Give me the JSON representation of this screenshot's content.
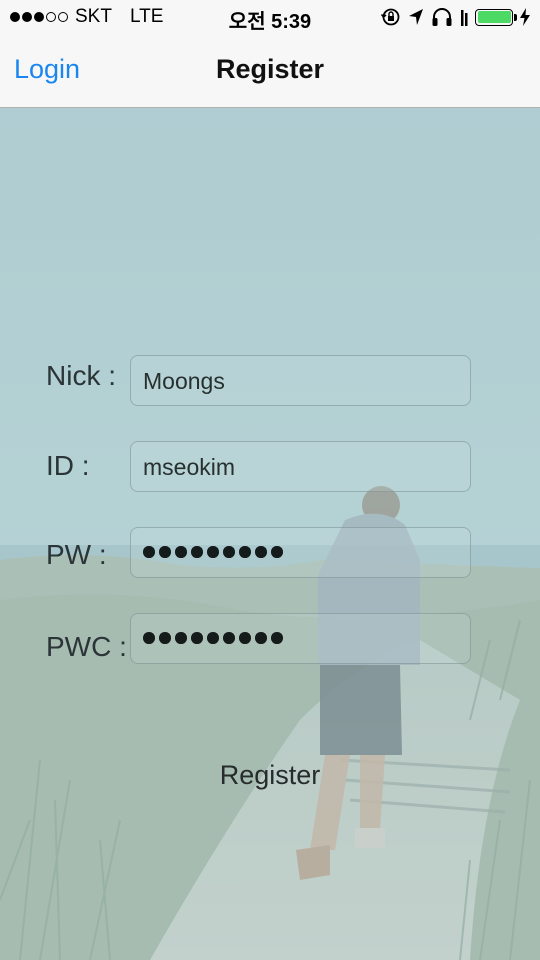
{
  "status_bar": {
    "carrier": "SKT",
    "network": "LTE",
    "time": "오전 5:39",
    "signal_bars_filled": 3,
    "signal_bars_total": 5,
    "battery_level": 1.0,
    "battery_color": "#4cd964",
    "icons": [
      "orientation-lock-icon",
      "location-arrow-icon",
      "headphones-icon",
      "battery-icon",
      "charging-bolt-icon"
    ]
  },
  "nav": {
    "back_label": "Login",
    "title": "Register",
    "accent_color": "#1a87f0"
  },
  "form": {
    "nick": {
      "label": "Nick :",
      "value": "Moongs"
    },
    "id": {
      "label": "ID :",
      "value": "mseokim"
    },
    "pw": {
      "label": "PW :",
      "masked_length": 9
    },
    "pwc": {
      "label": "PWC :",
      "masked_length": 9
    }
  },
  "register_button": {
    "label": "Register"
  }
}
